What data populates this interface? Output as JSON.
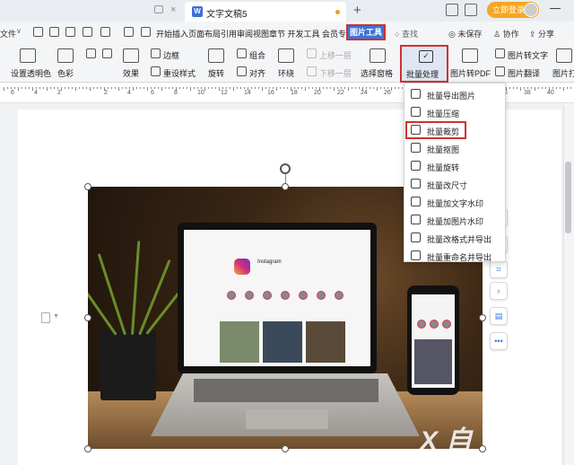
{
  "window": {
    "doc_tab_title": "文字文稿5",
    "doc_icon_letter": "W",
    "new_tab": "+",
    "close_glyph": "×",
    "login_button": "立即登录",
    "accent_login": "#f6a623"
  },
  "menubar": {
    "file": "文件",
    "file_chevron": "∨",
    "tabs_text": "开始插入页面布局引用审阅视图章节 开发工具 会员专享",
    "picture_tool": "图片工具",
    "search": "查找",
    "unsaved": "未保存",
    "collaborate": "协作",
    "share": "分享"
  },
  "ribbon": {
    "set_transparent": "设置透明色",
    "color": "色彩",
    "border": "边框",
    "effect": "效果",
    "reset_style": "重设样式",
    "rotate": "旋转",
    "group": "组合",
    "align": "对齐",
    "wrap": "环绕",
    "bring_forward": "上移一层",
    "send_backward": "下移一层",
    "selection_pane": "选择窗格",
    "batch_process": "批量处理",
    "pic_to_pdf": "图片转PDF",
    "pic_to_text": "图片转文字",
    "pic_translate": "图片翻译",
    "pic_print": "图片打"
  },
  "ruler": {
    "numbers": [
      "6",
      "4",
      "2",
      "",
      "2",
      "4",
      "6",
      "8",
      "10",
      "12",
      "14",
      "16",
      "18",
      "20",
      "22",
      "24",
      "26",
      "28",
      "30",
      "32",
      "34",
      "36",
      "38",
      "40"
    ]
  },
  "dropdown": {
    "items": [
      {
        "label": "批量导出图片",
        "icon": "export-image-icon"
      },
      {
        "label": "批量压缩",
        "icon": "compress-icon"
      },
      {
        "label": "批量裁剪",
        "icon": "crop-icon"
      },
      {
        "label": "批量抠图",
        "icon": "cutout-icon"
      },
      {
        "label": "批量旋转",
        "icon": "rotate-icon"
      },
      {
        "label": "批量改尺寸",
        "icon": "resize-icon"
      },
      {
        "label": "批量加文字水印",
        "icon": "text-watermark-icon"
      },
      {
        "label": "批量加图片水印",
        "icon": "image-watermark-icon"
      },
      {
        "label": "批量改格式并导出",
        "icon": "convert-format-icon"
      },
      {
        "label": "批量重命名并导出",
        "icon": "rename-icon"
      }
    ]
  },
  "side_tools": {
    "more": "•••"
  },
  "image": {
    "screen_title": "Instagram",
    "watermark": "X 自"
  },
  "colors": {
    "picture_tool_bg": "#3b73d8",
    "highlight_border": "#d0312d",
    "active_tab_dot": "#f39a1f"
  }
}
